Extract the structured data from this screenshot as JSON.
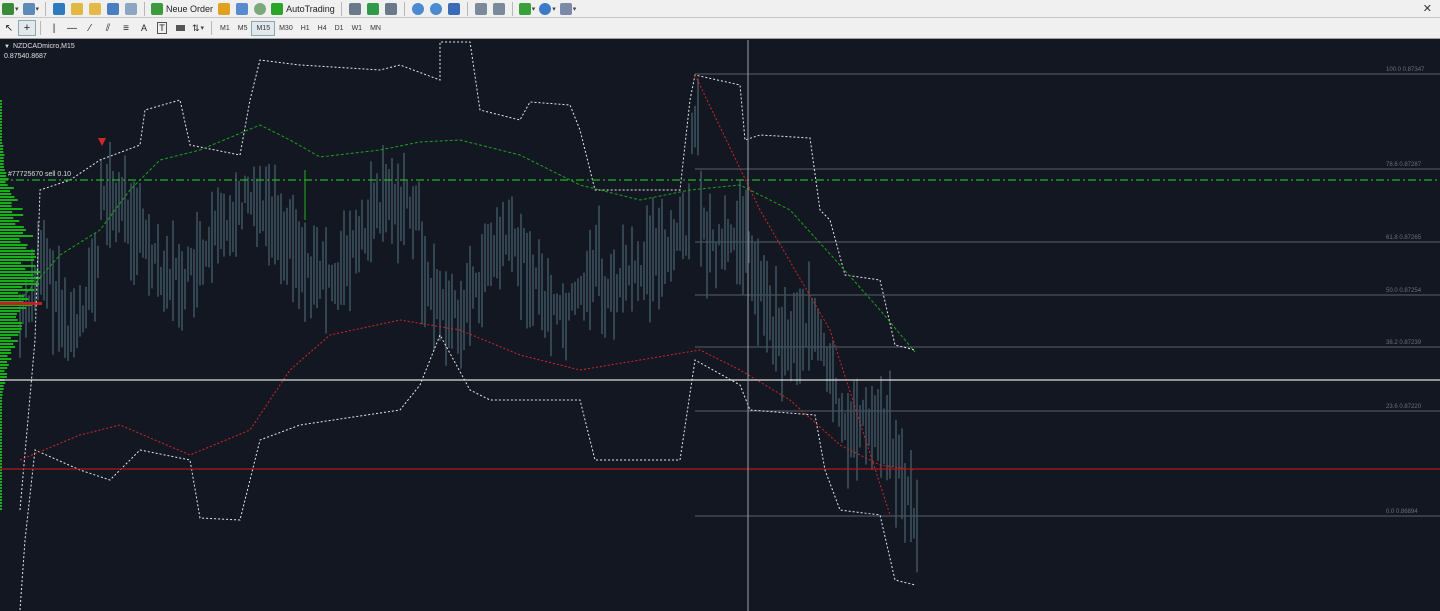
{
  "toolbar": {
    "neue_order_label": "Neue Order",
    "autotrading_label": "AutoTrading",
    "timeframes": [
      "M1",
      "M5",
      "M15",
      "M30",
      "H1",
      "H4",
      "D1",
      "W1",
      "MN"
    ],
    "active_timeframe": "M15",
    "close_glyph": "✕"
  },
  "chart": {
    "symbol": "NZDCADmicro,M15",
    "ohlc": "0.87540.8687",
    "order_line_label": "#77725670 sell 0.10",
    "fib_levels": [
      {
        "pct": "100.0",
        "price": "0.87347"
      },
      {
        "pct": "78.6",
        "price": "0.87287"
      },
      {
        "pct": "61.8",
        "price": "0.87265"
      },
      {
        "pct": "50.0",
        "price": "0.87254"
      },
      {
        "pct": "38.2",
        "price": "0.87239"
      },
      {
        "pct": "23.6",
        "price": "0.87220"
      },
      {
        "pct": "0.0",
        "price": "0.86894"
      }
    ],
    "colors": {
      "background": "#131722",
      "candles": "#3c5560",
      "upper_band": "#e8e8e8",
      "green_ma": "#1aa21a",
      "red_ma": "#d02828",
      "order_line": "#22b022",
      "red_hline": "#b01818",
      "white_hline": "#e0e0e0",
      "crosshair": "#9aa0a8",
      "fib_line": "#5a6068",
      "volume_profile": "#18b018"
    }
  }
}
